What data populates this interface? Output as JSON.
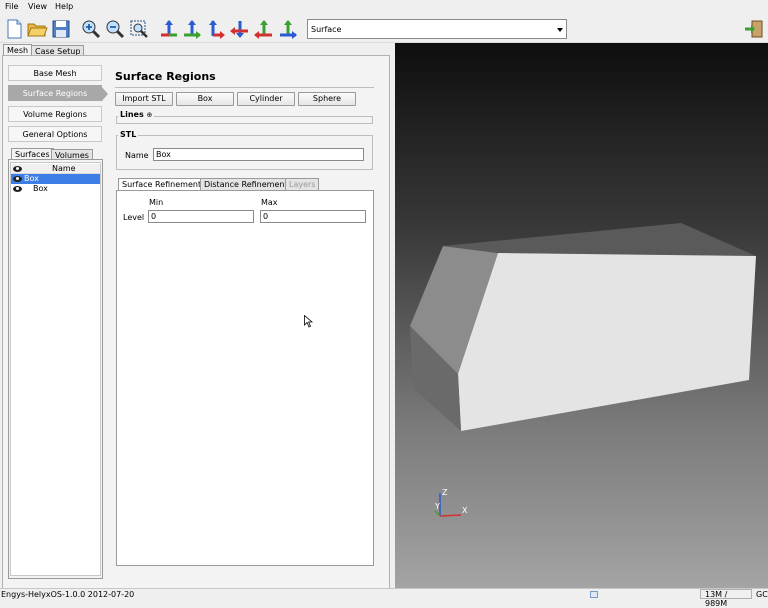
{
  "menu": [
    "File",
    "View",
    "Help"
  ],
  "toolbar": {
    "view_mode": "Surface",
    "icons": [
      "new-file-icon",
      "open-folder-icon",
      "save-icon",
      "zoom-in-icon",
      "zoom-out-icon",
      "zoom-fit-icon",
      "view-axis-icon",
      "view-axis-icon",
      "view-axis-icon",
      "view-axis-icon",
      "view-axis-icon",
      "view-axis-icon",
      "exit-icon"
    ]
  },
  "left_tabs": [
    "Mesh",
    "Case Setup"
  ],
  "nav": [
    "Base Mesh",
    "Surface Regions",
    "Volume Regions",
    "General Options"
  ],
  "tree_tabs": [
    "Surfaces",
    "Volumes"
  ],
  "tree": {
    "header": "Name",
    "rows": [
      {
        "label": "Box",
        "selected": true
      },
      {
        "label": "Box",
        "selected": false
      }
    ]
  },
  "panel": {
    "title": "Surface Regions",
    "buttons": [
      "Import STL",
      "Box",
      "Cylinder",
      "Sphere"
    ],
    "lines_label": "Lines",
    "stl_group": "STL",
    "name_label": "Name",
    "name_value": "Box",
    "subtabs": [
      "Surface Refinement",
      "Distance Refinement",
      "Layers"
    ],
    "min_label": "Min",
    "max_label": "Max",
    "level_label": "Level",
    "min_value": "0",
    "max_value": "0"
  },
  "viewport": {
    "axis": {
      "z": "Z",
      "y": "Y",
      "x": "X"
    }
  },
  "status": {
    "left": "Engys-HelyxOS-1.0.0 2012-07-20",
    "memory": "13M / 989M",
    "gc": "GC"
  }
}
